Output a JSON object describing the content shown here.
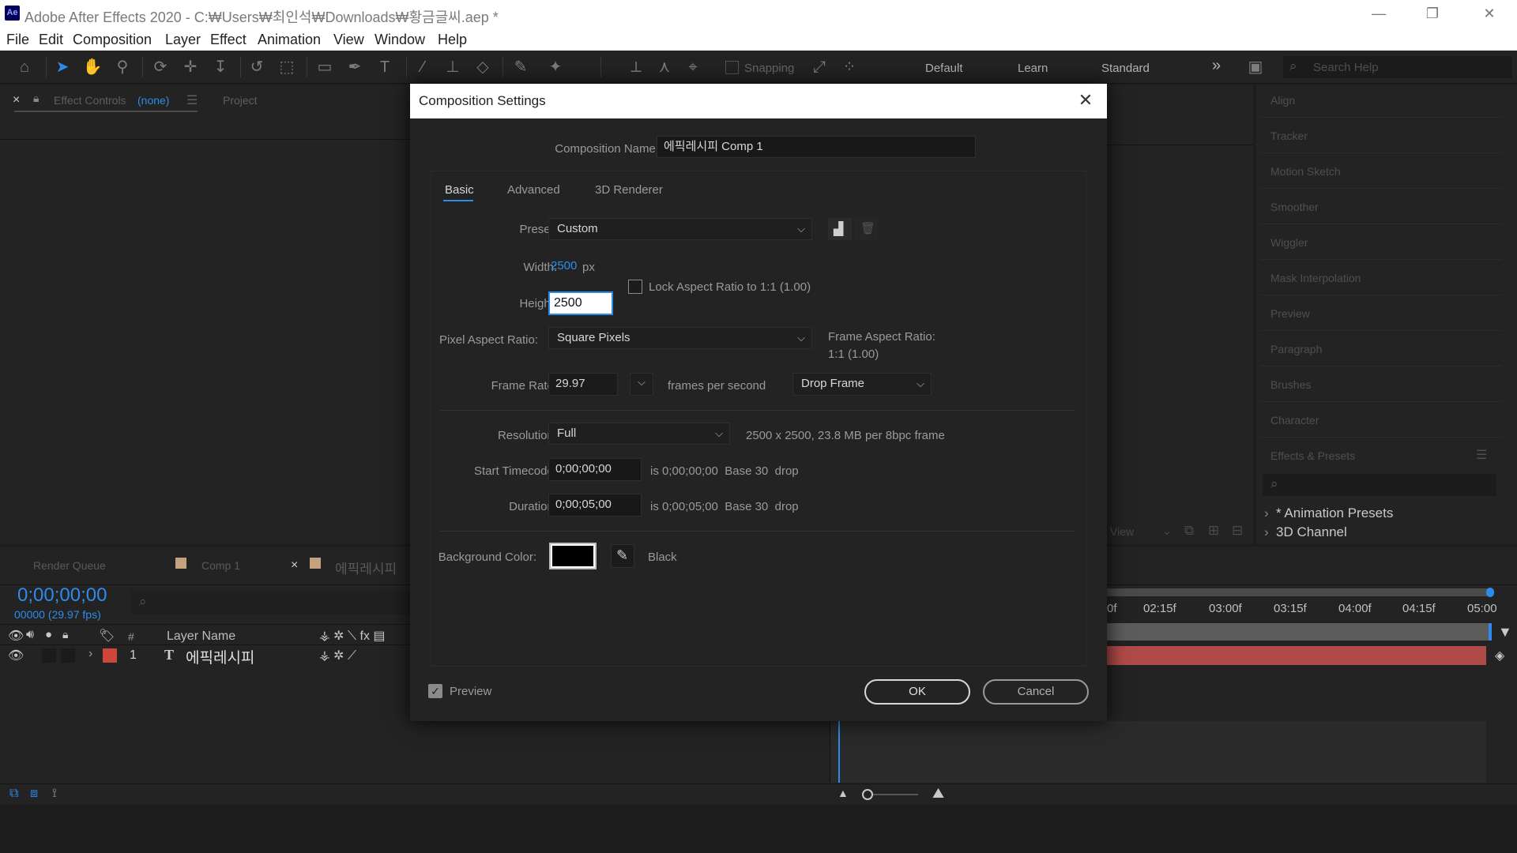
{
  "app": {
    "title": "Adobe After Effects 2020 - C:₩Users₩최인석₩Downloads₩황금글씨.aep *",
    "logo": "Ae"
  },
  "window_controls": {
    "minimize": "—",
    "restore": "❐",
    "close": "✕"
  },
  "menu": [
    "File",
    "Edit",
    "Composition",
    "Layer",
    "Effect",
    "Animation",
    "View",
    "Window",
    "Help"
  ],
  "toolbar": {
    "snapping_label": "Snapping",
    "workspaces": [
      "Default",
      "Learn",
      "Standard"
    ],
    "more": "»",
    "search_placeholder": "Search Help"
  },
  "left_panel": {
    "close": "×",
    "effect_controls_label": "Effect Controls",
    "effect_controls_target": "(none)",
    "project_label": "Project"
  },
  "right_panel": {
    "items": [
      "Align",
      "Tracker",
      "Motion Sketch",
      "Smoother",
      "Wiggler",
      "Mask Interpolation",
      "Preview",
      "Paragraph",
      "Brushes",
      "Character",
      "Effects & Presets"
    ],
    "tree": [
      "* Animation Presets",
      "3D Channel"
    ]
  },
  "viewer_footer": {
    "view_label": "View"
  },
  "timeline": {
    "tabs": [
      "Render Queue",
      "Comp 1",
      "에픽레시피"
    ],
    "close": "×",
    "timecode": "0;00;00;00",
    "frames": "00000 (29.97 fps)",
    "columns": {
      "number": "#",
      "layer_name": "Layer Name"
    },
    "layer": {
      "index": "1",
      "type": "T",
      "name": "에픽레시피"
    },
    "ruler_ticks": [
      "0f",
      "02:15f",
      "03:00f",
      "03:15f",
      "04:00f",
      "04:15f",
      "05:00"
    ]
  },
  "dialog": {
    "title": "Composition Settings",
    "close": "✕",
    "comp_name_label": "Composition Name:",
    "comp_name_value": "에픽레시피 Comp 1",
    "tabs": [
      "Basic",
      "Advanced",
      "3D Renderer"
    ],
    "active_tab": "Basic",
    "preset_label": "Preset:",
    "preset_value": "Custom",
    "width_label": "Width:",
    "width_value": "2500",
    "width_unit": "px",
    "height_label": "Height:",
    "height_value": "2500",
    "lock_aspect_label": "Lock Aspect Ratio to 1:1 (1.00)",
    "lock_aspect_checked": false,
    "par_label": "Pixel Aspect Ratio:",
    "par_value": "Square Pixels",
    "frame_aspect_label": "Frame Aspect Ratio:",
    "frame_aspect_value": "1:1 (1.00)",
    "frame_rate_label": "Frame Rate:",
    "frame_rate_value": "29.97",
    "fps_label": "frames per second",
    "drop_frame_value": "Drop Frame",
    "resolution_label": "Resolution:",
    "resolution_value": "Full",
    "resolution_info": "2500 x 2500, 23.8 MB per 8bpc frame",
    "start_tc_label": "Start Timecode:",
    "start_tc_value": "0;00;00;00",
    "start_tc_info": "is 0;00;00;00  Base 30  drop",
    "duration_label": "Duration:",
    "duration_value": "0;00;05;00",
    "duration_info": "is 0;00;05;00  Base 30  drop",
    "bg_color_label": "Background Color:",
    "bg_color_value": "#000000",
    "bg_color_name": "Black",
    "preview_label": "Preview",
    "preview_checked": true,
    "ok_label": "OK",
    "cancel_label": "Cancel"
  },
  "colors": {
    "accent": "#2d8ceb",
    "panel_bg": "#232323",
    "layer_bar": "#b04a48",
    "label_red": "#d0453a",
    "label_tan": "#c2a27f"
  }
}
